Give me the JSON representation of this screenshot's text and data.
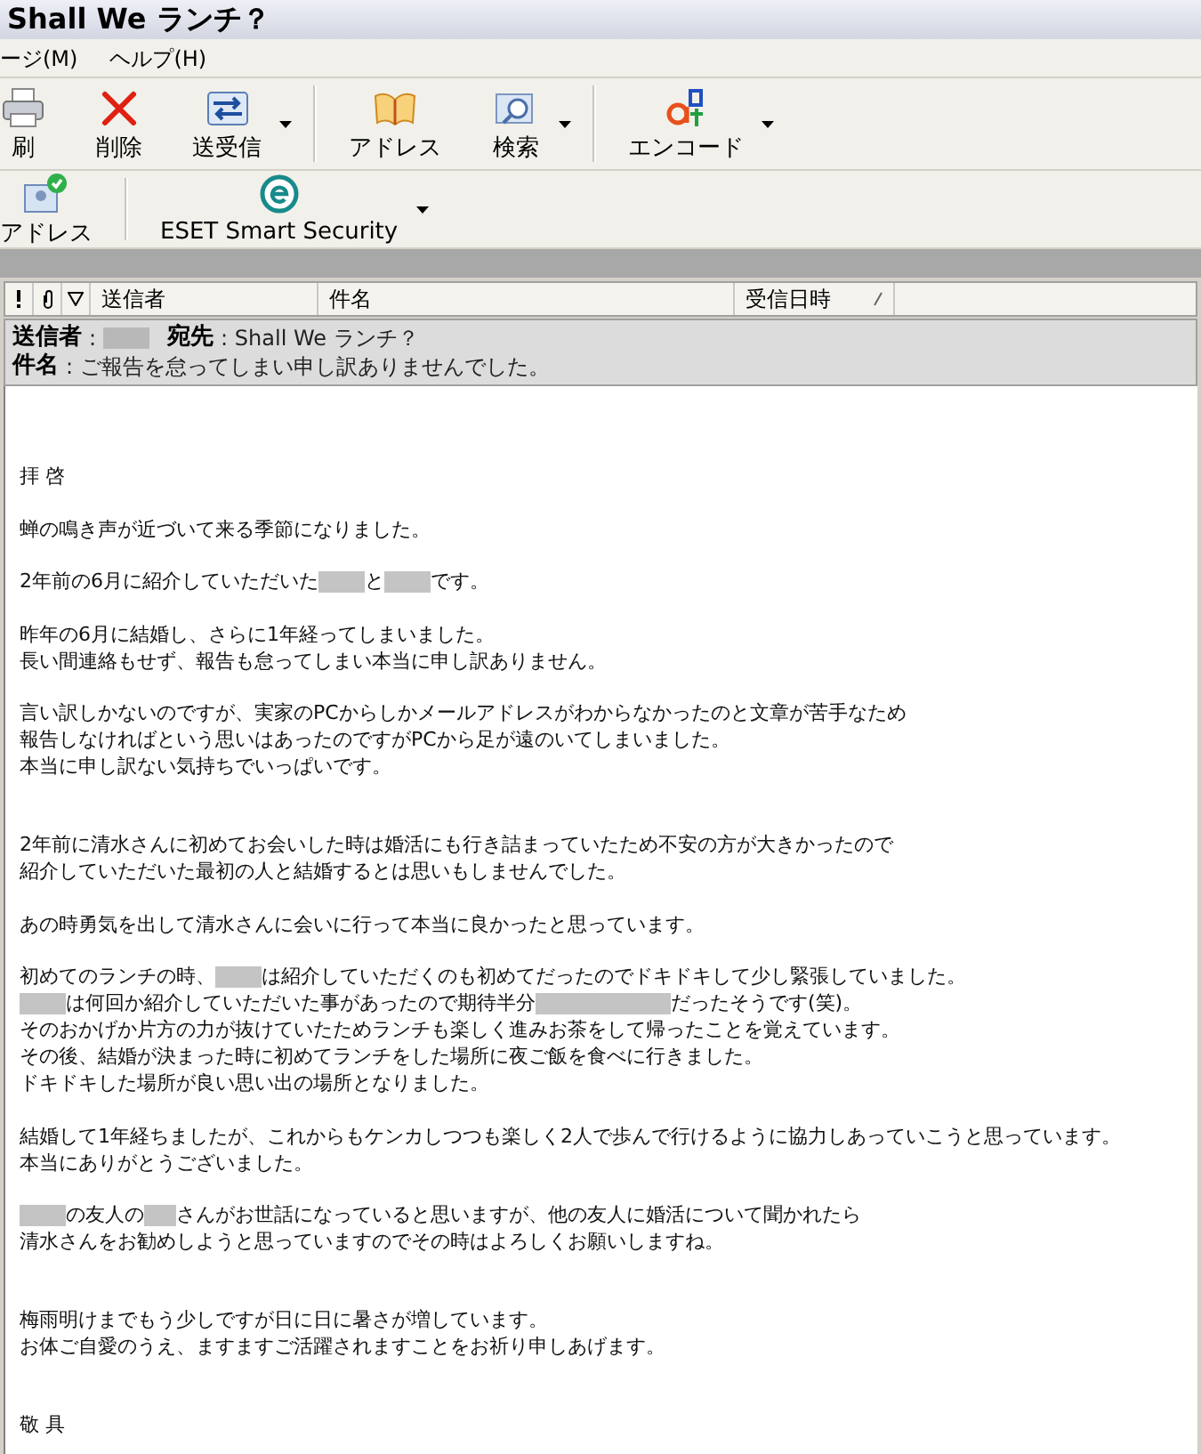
{
  "window": {
    "title": "Shall We ランチ？"
  },
  "menu": [
    {
      "label": "ージ(M)"
    },
    {
      "label": "ヘルプ(H)"
    }
  ],
  "toolbar": [
    {
      "kind": "button",
      "label": "刷",
      "dropdown": false
    },
    {
      "kind": "button",
      "label": "削除",
      "dropdown": false
    },
    {
      "kind": "button",
      "label": "送受信",
      "dropdown": true
    },
    {
      "kind": "separator"
    },
    {
      "kind": "button",
      "label": "アドレス",
      "dropdown": false
    },
    {
      "kind": "button",
      "label": "検索",
      "dropdown": true
    },
    {
      "kind": "separator"
    },
    {
      "kind": "button",
      "label": "エンコード",
      "dropdown": true
    }
  ],
  "toolbar2": [
    {
      "kind": "button",
      "label": "アドレス",
      "dropdown": false
    },
    {
      "kind": "separator"
    },
    {
      "kind": "button",
      "label": "ESET Smart Security",
      "dropdown": true
    }
  ],
  "columns": [
    {
      "label": "送信者",
      "sorted": false
    },
    {
      "label": "件名",
      "sorted": false
    },
    {
      "label": "受信日時",
      "sorted": true
    }
  ],
  "preview_header": [
    [
      {
        "label": "送信者",
        "value": ":",
        "redacted": true
      },
      {
        "label": "宛先",
        "value": ": Shall We ランチ？",
        "redacted": false
      }
    ],
    [
      {
        "label": "件名",
        "value": ": ご報告を怠ってしまい申し訳ありませんでした。",
        "redacted": false
      }
    ]
  ],
  "body": [
    {
      "section_break": true,
      "lines": [
        [
          {
            "kind": "text",
            "text": "拝 啓"
          }
        ]
      ]
    },
    {
      "section_break": false,
      "lines": [
        [
          {
            "kind": "text",
            "text": "蝉の鳴き声が近づいて来る季節になりました。"
          }
        ]
      ]
    },
    {
      "section_break": false,
      "lines": [
        [
          {
            "kind": "text",
            "text": "2年前の6月に紹介していただいた"
          },
          {
            "kind": "blur"
          },
          {
            "kind": "text",
            "text": "と"
          },
          {
            "kind": "blur"
          },
          {
            "kind": "text",
            "text": "です。"
          }
        ]
      ]
    },
    {
      "section_break": false,
      "lines": [
        [
          {
            "kind": "text",
            "text": "昨年の6月に結婚し、さらに1年経ってしまいました。"
          }
        ],
        [
          {
            "kind": "text",
            "text": "長い間連絡もせず、報告も怠ってしまい本当に申し訳ありません。"
          }
        ]
      ]
    },
    {
      "section_break": false,
      "lines": [
        [
          {
            "kind": "text",
            "text": "言い訳しかないのですが、実家のPCからしかメールアドレスがわからなかったのと文章が苦手なため"
          }
        ],
        [
          {
            "kind": "text",
            "text": "報告しなければという思いはあったのですがPCから足が遠のいてしまいました。"
          }
        ],
        [
          {
            "kind": "text",
            "text": "本当に申し訳ない気持ちでいっぱいです。"
          }
        ]
      ]
    },
    {
      "section_break": true,
      "lines": [
        [
          {
            "kind": "text",
            "text": "2年前に清水さんに初めてお会いした時は婚活にも行き詰まっていたため不安の方が大きかったので"
          }
        ],
        [
          {
            "kind": "text",
            "text": "紹介していただいた最初の人と結婚するとは思いもしませんでした。"
          }
        ]
      ]
    },
    {
      "section_break": false,
      "lines": [
        [
          {
            "kind": "text",
            "text": "あの時勇気を出して清水さんに会いに行って本当に良かったと思っています。"
          }
        ]
      ]
    },
    {
      "section_break": false,
      "lines": [
        [
          {
            "kind": "text",
            "text": "初めてのランチの時、"
          },
          {
            "kind": "blur"
          },
          {
            "kind": "text",
            "text": "は紹介していただくのも初めてだったのでドキドキして少し緊張していました。"
          }
        ],
        [
          {
            "kind": "blur"
          },
          {
            "kind": "text",
            "text": "は何回か紹介していただいた事があったので期待半分"
          },
          {
            "kind": "longblur"
          },
          {
            "kind": "text",
            "text": "だったそうです(笑)。"
          }
        ],
        [
          {
            "kind": "text",
            "text": "そのおかげか片方の力が抜けていたためランチも楽しく進みお茶をして帰ったことを覚えています。"
          }
        ],
        [
          {
            "kind": "text",
            "text": "その後、結婚が決まった時に初めてランチをした場所に夜ご飯を食べに行きました。"
          }
        ],
        [
          {
            "kind": "text",
            "text": "ドキドキした場所が良い思い出の場所となりました。"
          }
        ]
      ]
    },
    {
      "section_break": false,
      "lines": [
        [
          {
            "kind": "text",
            "text": "結婚して1年経ちましたが、これからもケンカしつつも楽しく2人で歩んで行けるように協力しあっていこうと思っています。"
          }
        ],
        [
          {
            "kind": "text",
            "text": "本当にありがとうございました。"
          }
        ]
      ]
    },
    {
      "section_break": false,
      "lines": [
        [
          {
            "kind": "blur"
          },
          {
            "kind": "text",
            "text": "の友人の"
          },
          {
            "kind": "shortblur"
          },
          {
            "kind": "text",
            "text": "さんがお世話になっていると思いますが、他の友人に婚活について聞かれたら"
          }
        ],
        [
          {
            "kind": "text",
            "text": "清水さんをお勧めしようと思っていますのでその時はよろしくお願いしますね。"
          }
        ]
      ]
    },
    {
      "section_break": true,
      "lines": [
        [
          {
            "kind": "text",
            "text": "梅雨明けまでもう少しですが日に日に暑さが増しています。"
          }
        ],
        [
          {
            "kind": "text",
            "text": "お体ご自愛のうえ、ますますご活躍されますことをお祈り申しあげます。"
          }
        ]
      ]
    },
    {
      "section_break": true,
      "lines": [
        [
          {
            "kind": "text",
            "text": "敬 具"
          }
        ]
      ]
    }
  ]
}
